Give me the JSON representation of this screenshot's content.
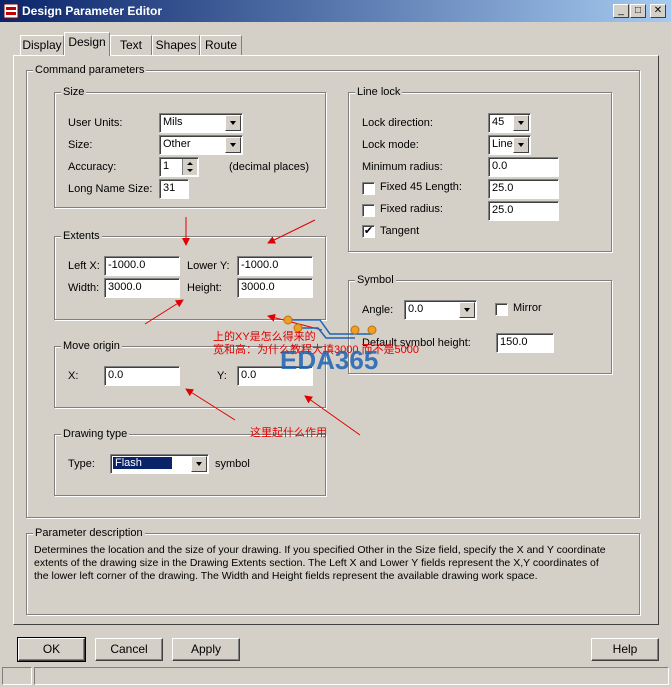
{
  "window": {
    "title": "Design Parameter Editor"
  },
  "tabs": [
    {
      "label": "Display"
    },
    {
      "label": "Design"
    },
    {
      "label": "Text"
    },
    {
      "label": "Shapes"
    },
    {
      "label": "Route"
    }
  ],
  "command_parameters": {
    "title": "Command parameters",
    "size": {
      "title": "Size",
      "user_units_label": "User Units:",
      "user_units_value": "Mils",
      "size_label": "Size:",
      "size_value": "Other",
      "accuracy_label": "Accuracy:",
      "accuracy_value": "1",
      "accuracy_hint": "(decimal places)",
      "long_name_label": "Long Name Size:",
      "long_name_value": "31"
    },
    "extents": {
      "title": "Extents",
      "left_x_label": "Left X:",
      "left_x_value": "-1000.0",
      "lower_y_label": "Lower Y:",
      "lower_y_value": "-1000.0",
      "width_label": "Width:",
      "width_value": "3000.0",
      "height_label": "Height:",
      "height_value": "3000.0"
    },
    "move_origin": {
      "title": "Move origin",
      "x_label": "X:",
      "x_value": "0.0",
      "y_label": "Y:",
      "y_value": "0.0"
    },
    "drawing_type": {
      "title": "Drawing type",
      "type_label": "Type:",
      "type_value": "Flash",
      "suffix": "symbol"
    },
    "line_lock": {
      "title": "Line lock",
      "lock_direction_label": "Lock direction:",
      "lock_direction_value": "45",
      "lock_mode_label": "Lock mode:",
      "lock_mode_value": "Line",
      "min_radius_label": "Minimum radius:",
      "min_radius_value": "0.0",
      "fixed45_label": "Fixed 45 Length:",
      "fixed45_value": "25.0",
      "fixed45_checked": false,
      "fixed_radius_label": "Fixed radius:",
      "fixed_radius_value": "25.0",
      "fixed_radius_checked": false,
      "tangent_label": "Tangent",
      "tangent_checked": true
    },
    "symbol": {
      "title": "Symbol",
      "angle_label": "Angle:",
      "angle_value": "0.0",
      "mirror_label": "Mirror",
      "mirror_checked": false,
      "default_height_label": "Default symbol height:",
      "default_height_value": "150.0"
    }
  },
  "parameter_description": {
    "title": "Parameter description",
    "line1": "Determines the location and the size of your drawing.  If you specified Other in the Size field, specify the X and Y coordinate",
    "line2": "extents of the drawing size in the Drawing Extents section. The Left X and Lower Y fields represent the X,Y coordinates of",
    "line3": "the lower left corner of the drawing.  The Width and Height fields represent the available drawing work space."
  },
  "buttons": {
    "ok": "OK",
    "cancel": "Cancel",
    "apply": "Apply",
    "help": "Help"
  },
  "annotations": {
    "note1_line1": "上的XY是怎么得来的",
    "note1_line2": "宽和高：为什么教程大填3000  而不是5000",
    "note2": "这里起什么作用",
    "watermark": "EDA365",
    "accent": "#e00000",
    "watermark_color": "#1f63b5",
    "dot_color": "#f0a020"
  }
}
